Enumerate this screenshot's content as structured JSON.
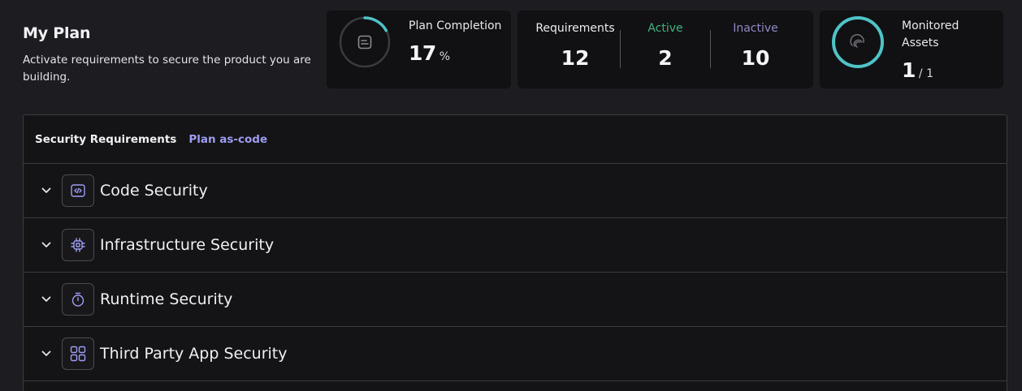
{
  "header": {
    "title": "My Plan",
    "subtitle": "Activate requirements to secure the product you are building."
  },
  "plan_completion": {
    "label": "Plan Completion",
    "value": "17",
    "unit": "%",
    "percent": 17,
    "ring_color": "#4fc3c7",
    "icon": "document-icon"
  },
  "requirements": {
    "total_label": "Requirements",
    "total_value": "12",
    "active_label": "Active",
    "active_value": "2",
    "active_color": "#3fb27f",
    "inactive_label": "Inactive",
    "inactive_value": "10",
    "inactive_color": "#8f88c9"
  },
  "monitored_assets": {
    "label_line1": "Monitored",
    "label_line2": "Assets",
    "value": "1",
    "total": "/ 1",
    "ring_color": "#4fc3c7",
    "icon": "fingerprint-icon"
  },
  "panel": {
    "title": "Security Requirements",
    "link": "Plan as-code",
    "accent": "#9d9cf3",
    "rows": [
      {
        "label": "Code Security",
        "icon": "code-icon"
      },
      {
        "label": "Infrastructure Security",
        "icon": "chip-icon"
      },
      {
        "label": "Runtime Security",
        "icon": "stopwatch-icon"
      },
      {
        "label": "Third Party App Security",
        "icon": "grid-apps-icon"
      }
    ]
  }
}
